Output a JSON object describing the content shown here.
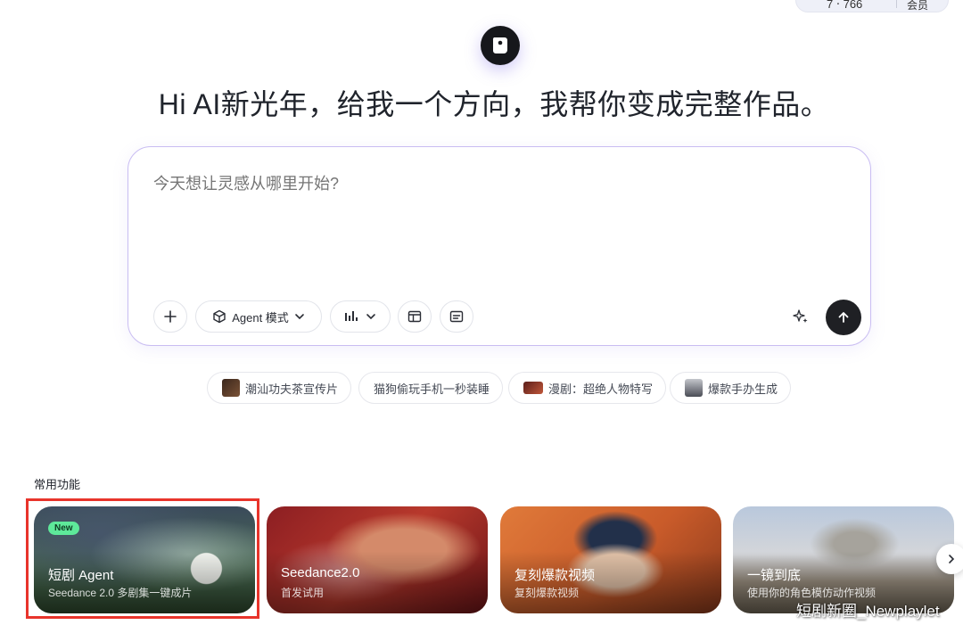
{
  "top_bar": {
    "credits": "7 ‧ 766",
    "side_label": "会员"
  },
  "hero": {
    "headline": "Hi AI新光年，给我一个方向，我帮你变成完整作品。"
  },
  "composer": {
    "placeholder": "今天想让灵感从哪里开始?",
    "mode_label": "Agent 模式",
    "icons": [
      "plus-icon",
      "cube-icon",
      "chevron-down-icon",
      "bar-chart-icon",
      "layout-icon",
      "subtitle-icon",
      "sparkle-icon",
      "arrow-up-icon"
    ]
  },
  "suggestions": [
    {
      "label": "潮汕功夫茶宣传片",
      "thumb_color": "#5a3a28"
    },
    {
      "label": "猫狗偷玩手机一秒装睡"
    },
    {
      "label": "漫剧：超绝人物特写",
      "thumb_color": "#9a3a2a"
    },
    {
      "label": "爆款手办生成",
      "thumb_color": "#6e7280"
    }
  ],
  "section": {
    "title": "常用功能"
  },
  "cards": [
    {
      "title": "短剧 Agent",
      "subtitle": "Seedance 2.0 多剧集一键成片",
      "badge": "New"
    },
    {
      "title": "Seedance2.0",
      "subtitle": "首发试用"
    },
    {
      "title": "复刻爆款视频",
      "subtitle": "复刻爆款视频"
    },
    {
      "title": "一镜到底",
      "subtitle": "使用你的角色模仿动作视频"
    }
  ],
  "watermark": "短剧新圈_Newplaylet",
  "colors": {
    "accent_border": "#c9bdf2",
    "highlight": "#e8342b",
    "new_badge": "#5ee89a"
  }
}
